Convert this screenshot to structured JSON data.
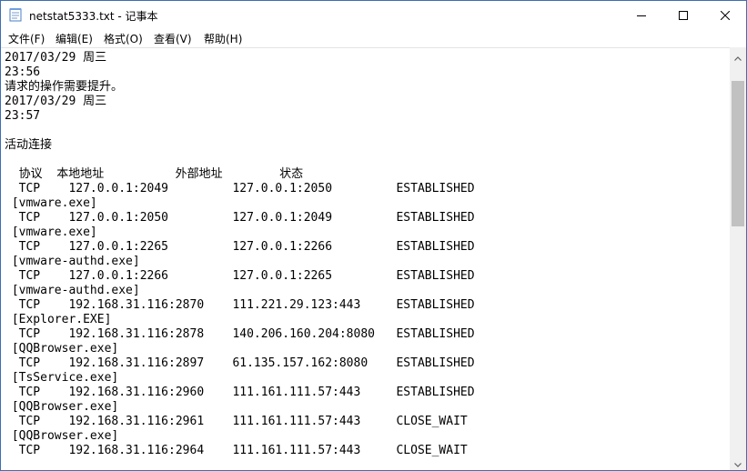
{
  "window": {
    "title": "netstat5333.txt - 记事本"
  },
  "icons": {
    "app": "notepad-icon",
    "minimize": "minimize-icon",
    "maximize": "maximize-icon",
    "close": "close-icon",
    "scroll_up": "chevron-up-icon",
    "scroll_down": "chevron-down-icon"
  },
  "menu": {
    "file": "文件(F)",
    "edit": "编辑(E)",
    "format": "格式(O)",
    "view": "查看(V)",
    "help": "帮助(H)"
  },
  "document": {
    "lines": [
      "2017/03/29 周三",
      "23:56",
      "请求的操作需要提升。",
      "2017/03/29 周三",
      "23:57",
      "",
      "活动连接",
      "",
      "  协议  本地地址          外部地址        状态",
      "  TCP    127.0.0.1:2049         127.0.0.1:2050         ESTABLISHED",
      " [vmware.exe]",
      "  TCP    127.0.0.1:2050         127.0.0.1:2049         ESTABLISHED",
      " [vmware.exe]",
      "  TCP    127.0.0.1:2265         127.0.0.1:2266         ESTABLISHED",
      " [vmware-authd.exe]",
      "  TCP    127.0.0.1:2266         127.0.0.1:2265         ESTABLISHED",
      " [vmware-authd.exe]",
      "  TCP    192.168.31.116:2870    111.221.29.123:443     ESTABLISHED",
      " [Explorer.EXE]",
      "  TCP    192.168.31.116:2878    140.206.160.204:8080   ESTABLISHED",
      " [QQBrowser.exe]",
      "  TCP    192.168.31.116:2897    61.135.157.162:8080    ESTABLISHED",
      " [TsService.exe]",
      "  TCP    192.168.31.116:2960    111.161.111.57:443     ESTABLISHED",
      " [QQBrowser.exe]",
      "  TCP    192.168.31.116:2961    111.161.111.57:443     CLOSE_WAIT",
      " [QQBrowser.exe]",
      "  TCP    192.168.31.116:2964    111.161.111.57:443     CLOSE_WAIT"
    ]
  }
}
